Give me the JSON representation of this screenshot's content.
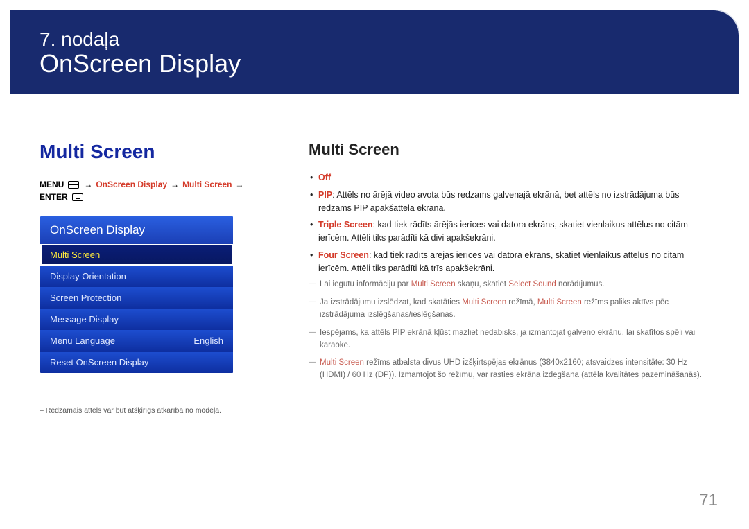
{
  "chapter": "7. nodaļa",
  "title": "OnScreen Display",
  "left": {
    "heading": "Multi Screen",
    "breadcrumb": {
      "menu": "MENU",
      "p1": "OnScreen Display",
      "p2": "Multi Screen",
      "enter": "ENTER"
    },
    "menuHeader": "OnScreen Display",
    "menuItems": [
      {
        "label": "Multi Screen",
        "value": ""
      },
      {
        "label": "Display Orientation",
        "value": ""
      },
      {
        "label": "Screen Protection",
        "value": ""
      },
      {
        "label": "Message Display",
        "value": ""
      },
      {
        "label": "Menu Language",
        "value": "English"
      },
      {
        "label": "Reset OnScreen Display",
        "value": ""
      }
    ],
    "footnote": "– Redzamais attēls var būt atšķirīgs atkarībā no modeļa."
  },
  "right": {
    "heading": "Multi Screen",
    "bullets": [
      {
        "lead": "Off",
        "text": ""
      },
      {
        "lead": "PIP",
        "text": ": Attēls no ārējā video avota būs redzams galvenajā ekrānā, bet attēls no izstrādājuma būs redzams PIP apakšattēla ekrānā."
      },
      {
        "lead": "Triple Screen",
        "text": ": kad tiek rādīts ārējās ierīces vai datora ekrāns, skatiet vienlaikus attēlus no citām ierīcēm. Attēli tiks parādīti kā divi apakšekrāni."
      },
      {
        "lead": "Four Screen",
        "text": ": kad tiek rādīts ārējās ierīces vai datora ekrāns, skatiet vienlaikus attēlus no citām ierīcēm. Attēli tiks parādīti kā trīs apakšekrāni."
      }
    ],
    "dashes": [
      {
        "pre": "Lai iegūtu informāciju par ",
        "r1": "Multi Screen",
        "mid": " skaņu, skatiet ",
        "r2": "Select Sound",
        "post": " norādījumus."
      },
      {
        "pre": "Ja izstrādājumu izslēdzat, kad skatāties ",
        "r1": "Multi Screen",
        "mid": " režīmā, ",
        "r2": "Multi Screen",
        "post": " režīms paliks aktīvs pēc izstrādājuma izslēgšanas/ieslēgšanas."
      },
      {
        "pre": "Iespējams, ka attēls PIP ekrānā kļūst mazliet nedabisks, ja izmantojat galveno ekrānu, lai skatītos spēli vai karaoke.",
        "r1": "",
        "mid": "",
        "r2": "",
        "post": ""
      },
      {
        "pre": "",
        "r1": "Multi Screen",
        "mid": " režīms atbalsta divus UHD izšķirtspējas ekrānus (3840x2160; atsvaidzes intensitāte: 30 Hz (HDMI) / 60 Hz (DP)). Izmantojot šo režīmu, var rasties ekrāna izdegšana (attēla kvalitātes pazemināšanās).",
        "r2": "",
        "post": ""
      }
    ]
  },
  "pageNumber": "71"
}
